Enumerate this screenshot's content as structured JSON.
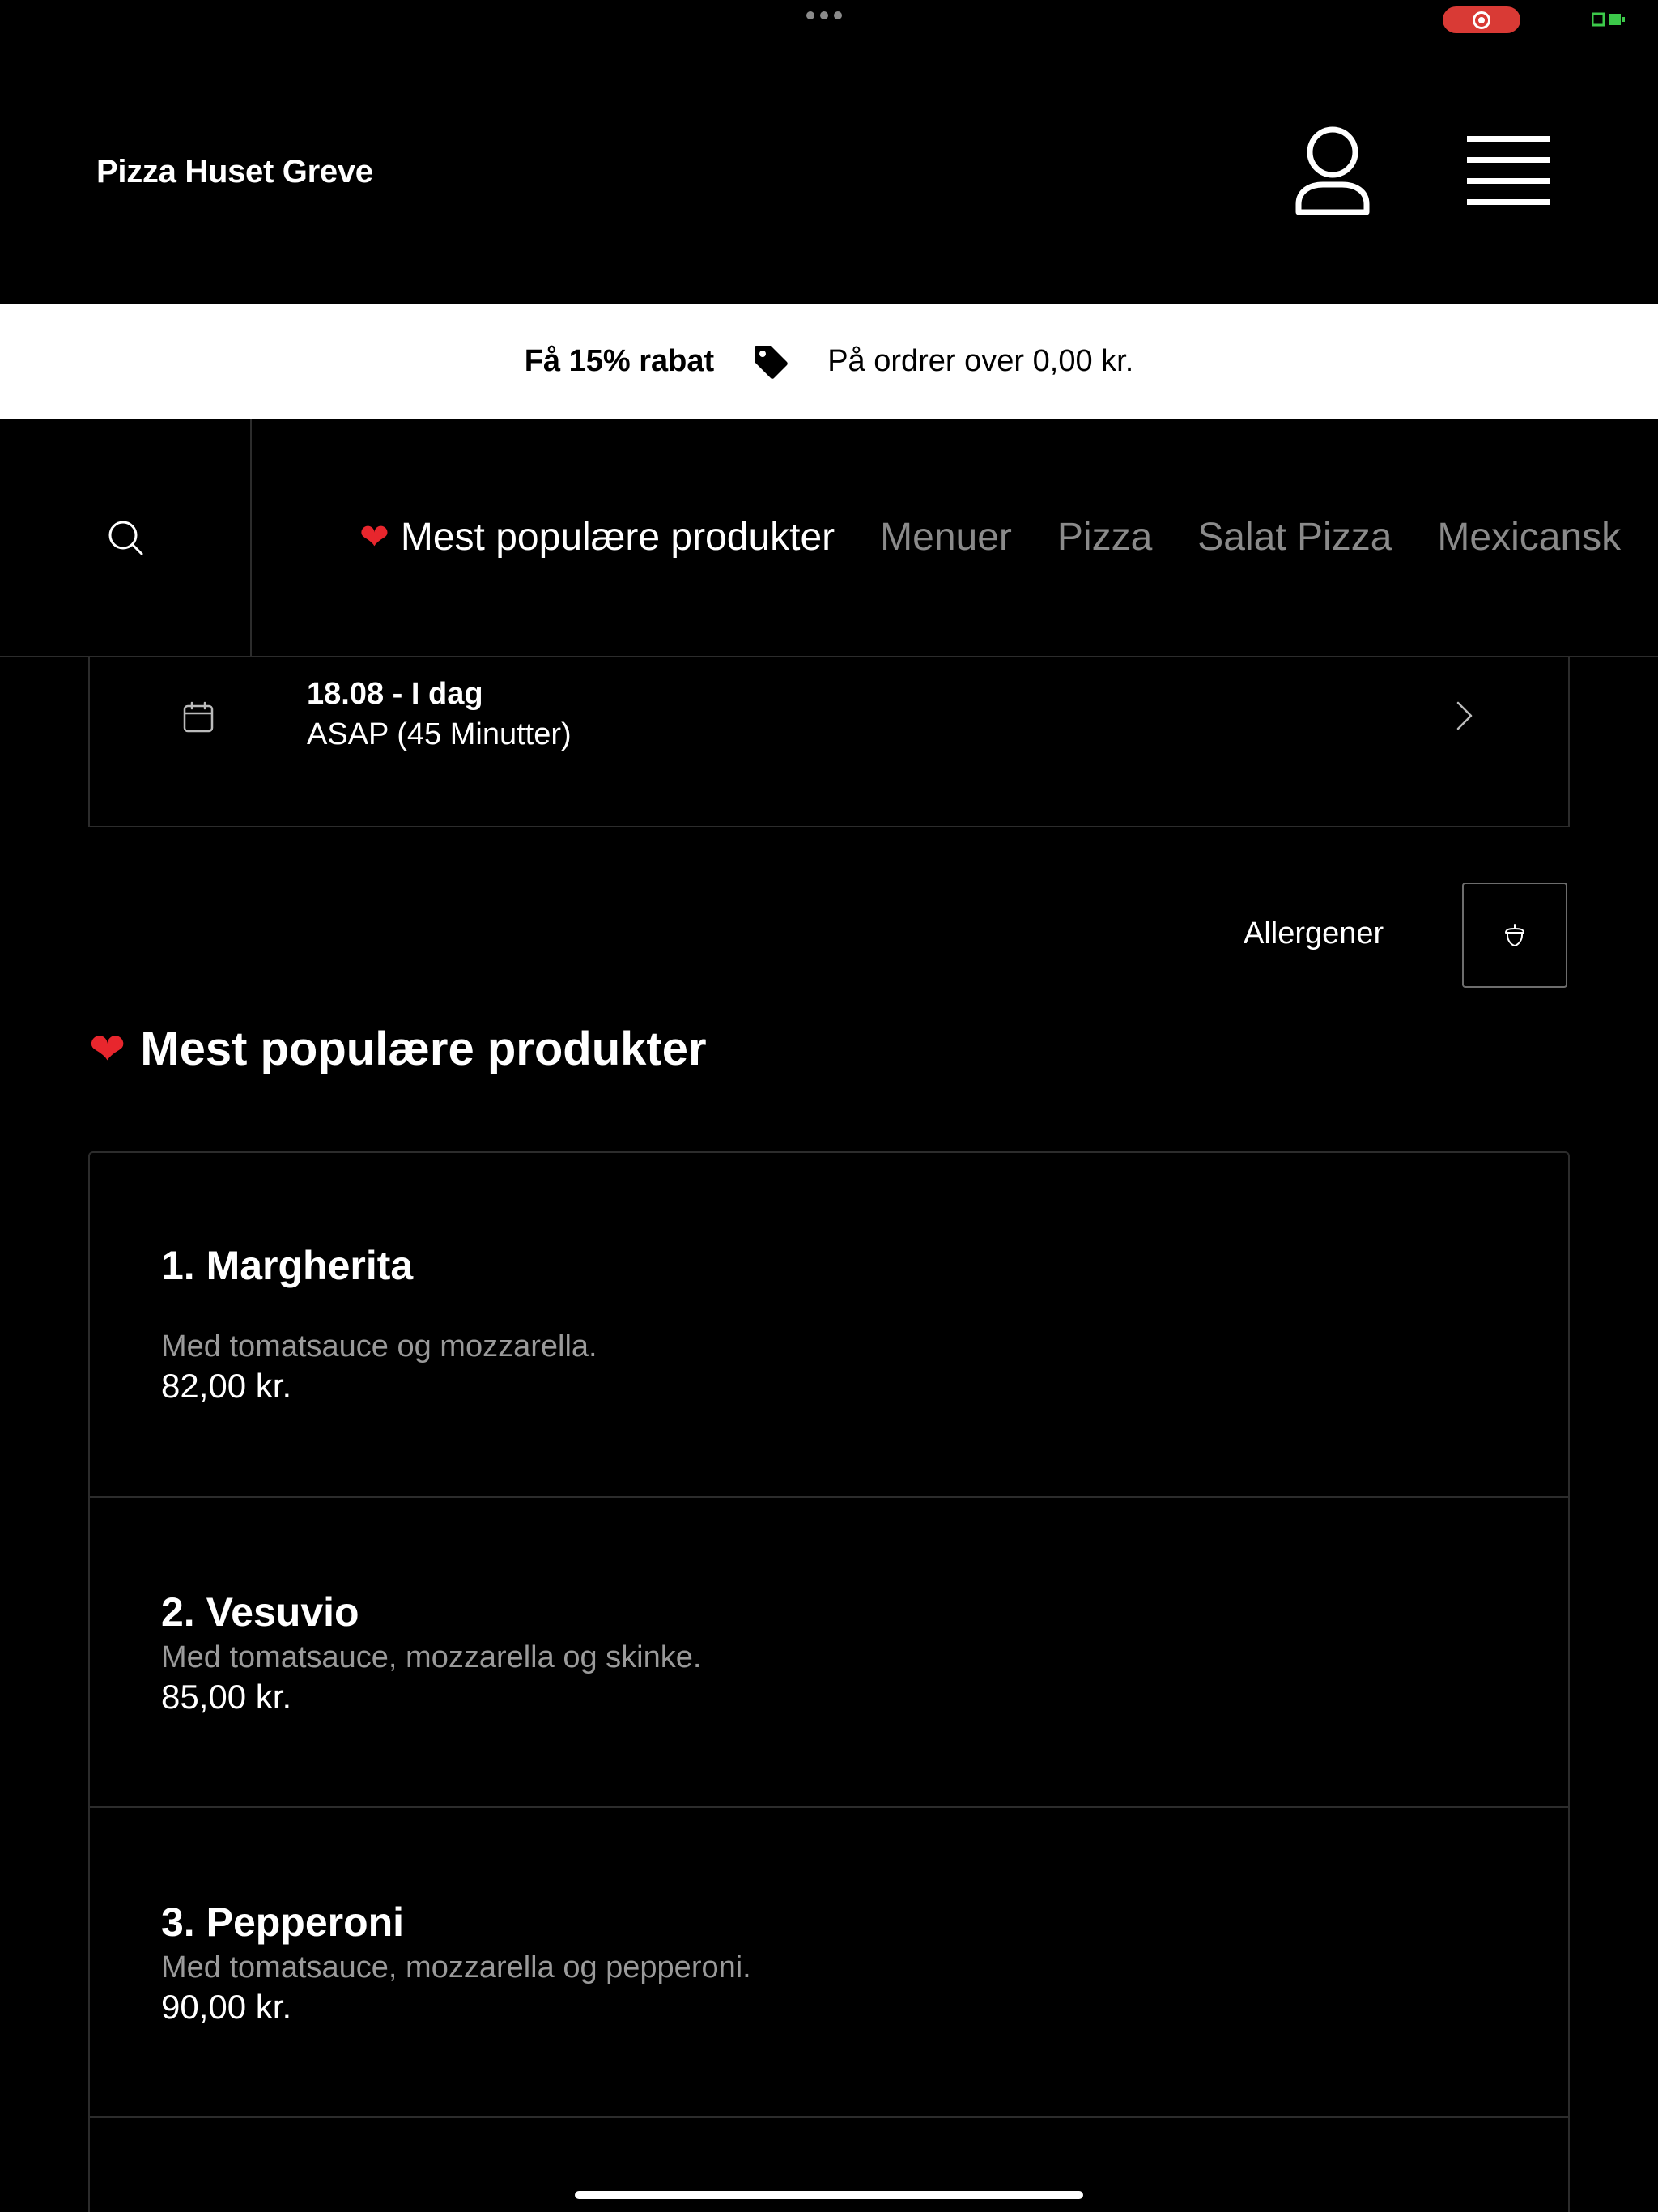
{
  "header": {
    "brand": "Pizza Huset Greve",
    "user_icon": "user-icon",
    "menu_icon": "hamburger-menu-icon"
  },
  "promo": {
    "headline": "Få 15% rabat",
    "icon": "tag-icon",
    "detail": "På ordrer over 0,00 kr."
  },
  "nav": {
    "search_icon": "search-icon",
    "tabs": [
      {
        "label": "Mest populære produkter",
        "emoji": "❤",
        "active": true
      },
      {
        "label": "Menuer",
        "active": false
      },
      {
        "label": "Pizza",
        "active": false
      },
      {
        "label": "Salat Pizza",
        "active": false
      },
      {
        "label": "Mexicansk",
        "active": false
      }
    ]
  },
  "delivery": {
    "date": "18.08 - I dag",
    "eta": "ASAP (45 Minutter)"
  },
  "allergens": {
    "label": "Allergener",
    "icon": "acorn-icon"
  },
  "section": {
    "emoji": "❤",
    "title": "Mest populære produkter"
  },
  "products": [
    {
      "name": "1. Margherita",
      "description": "Med tomatsauce og mozzarella.",
      "price": "82,00 kr."
    },
    {
      "name": "2. Vesuvio",
      "description": "Med tomatsauce, mozzarella og skinke.",
      "price": "85,00 kr."
    },
    {
      "name": "3. Pepperoni",
      "description": "Med tomatsauce, mozzarella og pepperoni.",
      "price": "90,00 kr."
    }
  ],
  "colors": {
    "background": "#000000",
    "heart": "#e8262d",
    "recording": "#d93a35",
    "battery": "#3cc94a",
    "muted_text": "#8a8a8a"
  }
}
